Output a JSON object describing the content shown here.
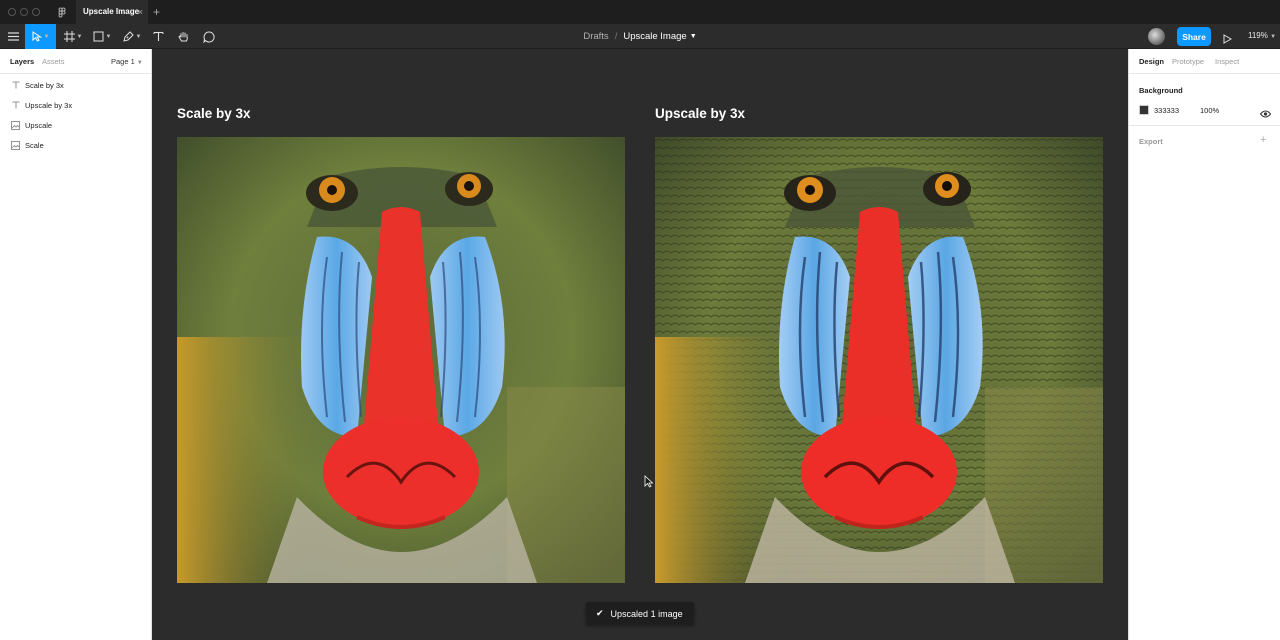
{
  "window": {
    "tab_title": "Upscale Image",
    "tab_close": "×",
    "tab_add": "+"
  },
  "toolbar": {
    "breadcrumb_parent": "Drafts",
    "breadcrumb_separator": "/",
    "file_name": "Upscale Image",
    "share_label": "Share",
    "zoom": "119%",
    "tools": [
      "menu-icon",
      "move-icon",
      "frame-icon",
      "rectangle-icon",
      "pen-icon",
      "text-icon",
      "hand-icon",
      "comment-icon"
    ]
  },
  "left_panel": {
    "tabs": [
      "Layers",
      "Assets"
    ],
    "page": "Page 1",
    "layers": [
      {
        "name": "Scale by 3x",
        "icon": "text-layer-icon"
      },
      {
        "name": "Upscale by 3x",
        "icon": "text-layer-icon"
      },
      {
        "name": "Upscale",
        "icon": "image-layer-icon"
      },
      {
        "name": "Scale",
        "icon": "image-layer-icon"
      }
    ]
  },
  "canvas": {
    "frames": [
      {
        "label": "Scale by 3x"
      },
      {
        "label": "Upscale by 3x"
      }
    ],
    "toast": "Upscaled 1 image",
    "help": "?"
  },
  "right_panel": {
    "tabs": [
      "Design",
      "Prototype",
      "Inspect"
    ],
    "background_title": "Background",
    "background_hex": "333333",
    "background_opacity": "100%",
    "export_title": "Export",
    "export_add": "+"
  },
  "colors": {
    "accent": "#0d99ff",
    "canvas_bg": "#2c2c2c",
    "background_swatch": "#333333"
  }
}
